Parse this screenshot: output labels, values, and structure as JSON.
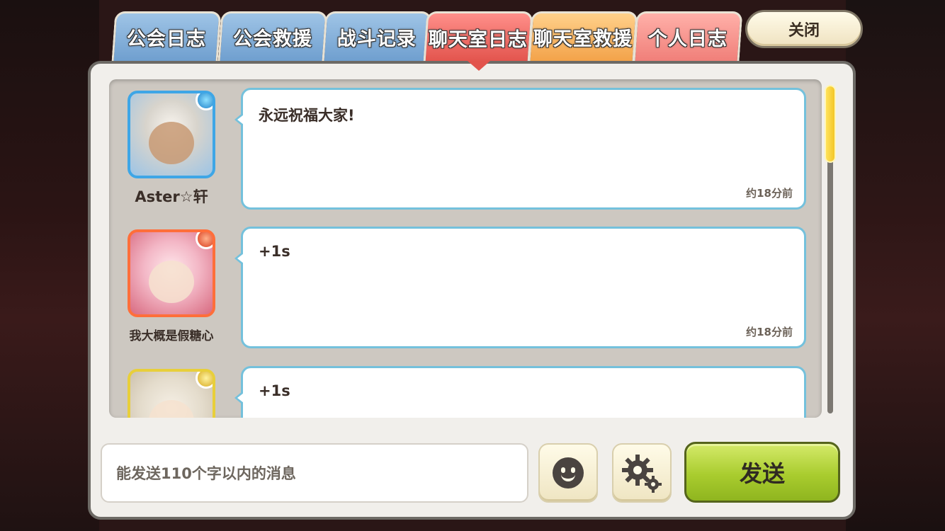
{
  "tabs": [
    {
      "label": "公会日志",
      "style": "blue",
      "active": false
    },
    {
      "label": "公会救援",
      "style": "blue",
      "active": false
    },
    {
      "label": "战斗记录",
      "style": "blue",
      "active": false
    },
    {
      "label": "聊天室日志",
      "style": "red",
      "active": true
    },
    {
      "label": "聊天室救援",
      "style": "orange",
      "active": false
    },
    {
      "label": "个人日志",
      "style": "pink",
      "active": false
    }
  ],
  "close_label": "关闭",
  "messages": [
    {
      "name": "Aster☆轩",
      "text": "永远祝福大家!",
      "time": "约18分前",
      "element_icon": "water-element-icon"
    },
    {
      "name": "我大概是假糖心",
      "text": "+1s",
      "time": "约18分前",
      "element_icon": "fire-element-icon"
    },
    {
      "name": "",
      "text": "+1s",
      "time": "",
      "element_icon": "light-element-icon"
    }
  ],
  "input": {
    "placeholder": "能发送110个字以内的消息"
  },
  "buttons": {
    "emoji_icon": "smiley-icon",
    "settings_icon": "gear-icon",
    "send_label": "发送"
  },
  "colors": {
    "active_tab": "#e2534c",
    "send_button": "#a9cc2e",
    "bubble_border": "#74c1dc",
    "scroll_thumb": "#f3c628"
  }
}
